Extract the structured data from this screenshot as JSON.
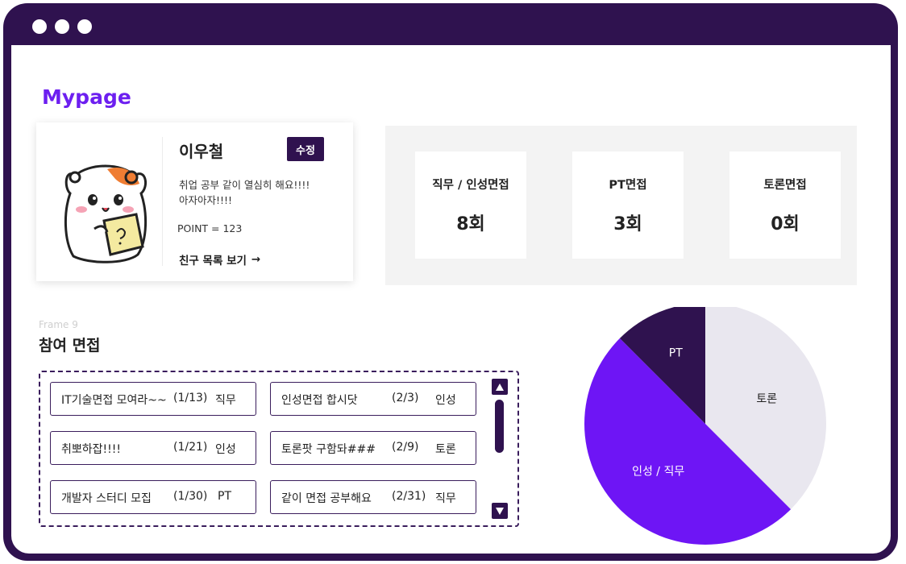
{
  "page": {
    "title": "Mypage"
  },
  "profile": {
    "name": "이우철",
    "edit_label": "수정",
    "bio_line1": "취업 공부 같이 열심히 해요!!!!",
    "bio_line2": "아자아자!!!!",
    "point": "POINT = 123",
    "friends_link": "친구 목록 보기",
    "friends_arrow": "→"
  },
  "stats": [
    {
      "label": "직무 / 인성면접",
      "value": "8회"
    },
    {
      "label": "PT면접",
      "value": "3회"
    },
    {
      "label": "토론면접",
      "value": "0회"
    }
  ],
  "interviews": {
    "frame_label": "Frame 9",
    "title": "참여 면접",
    "rooms": [
      {
        "title": "IT기술면접 모여라~~",
        "count": "(1/13)",
        "type": "직무"
      },
      {
        "title": "인성면접 합시닷",
        "count": "(2/3)",
        "type": "인성"
      },
      {
        "title": "취뽀하잡!!!!",
        "count": "(1/21)",
        "type": "인성"
      },
      {
        "title": "토론팟 구함돠###",
        "count": "(2/9)",
        "type": "토론"
      },
      {
        "title": "개발자 스터디 모집",
        "count": "(1/30)",
        "type": "PT"
      },
      {
        "title": "같이 면접 공부해요",
        "count": "(2/31)",
        "type": "직무"
      }
    ],
    "scroll_up_icon": "triangle-up",
    "scroll_down_icon": "triangle-down"
  },
  "chart_data": {
    "type": "pie",
    "slices": [
      {
        "label": "토론",
        "value": 37.5,
        "color": "#e9e7ef",
        "text_color": "#222222"
      },
      {
        "label": "인성 / 직무",
        "value": 50,
        "color": "#6e15f5",
        "text_color": "#ffffff"
      },
      {
        "label": "PT",
        "value": 12.5,
        "color": "#2f124f",
        "text_color": "#ffffff"
      }
    ],
    "start_angle_deg": 0,
    "legend": "none"
  },
  "colors": {
    "frame": "#2f124f",
    "accent": "#6d1ff0",
    "panel_bg": "#f3f3f3"
  }
}
